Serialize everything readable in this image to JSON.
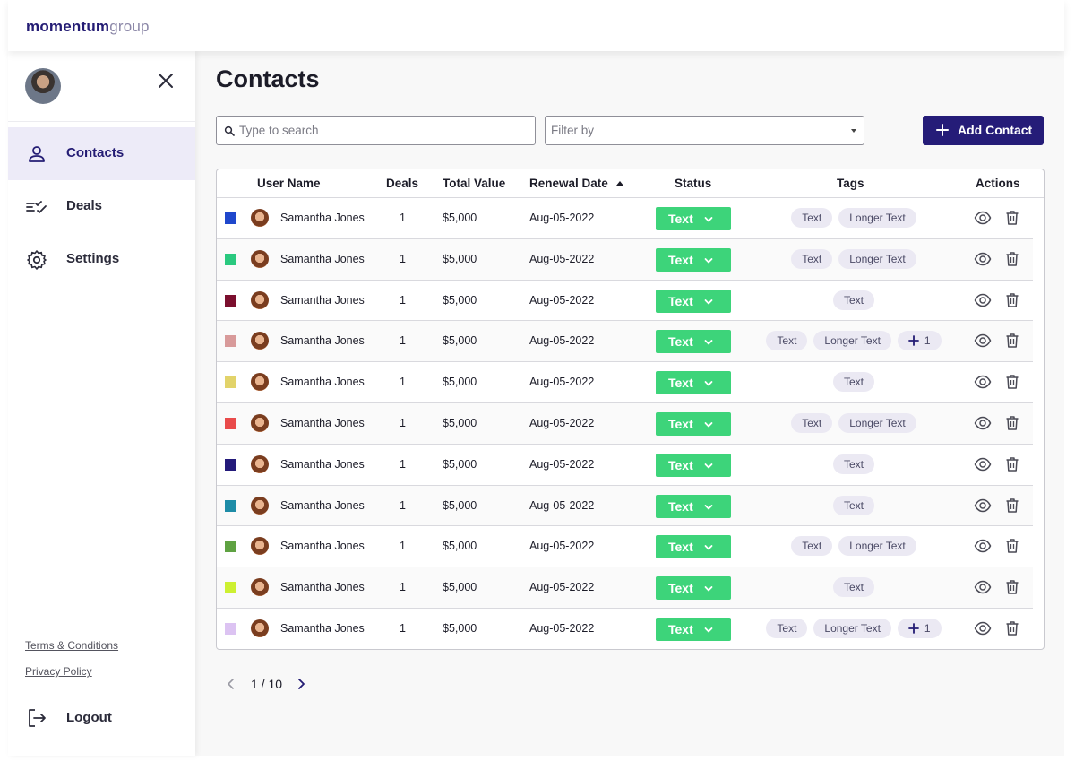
{
  "brand": {
    "logo_bold": "momentum",
    "logo_light": "group"
  },
  "sidebar": {
    "items": [
      {
        "label": "Contacts",
        "icon": "person-icon",
        "active": true
      },
      {
        "label": "Deals",
        "icon": "checklist-icon",
        "active": false
      },
      {
        "label": "Settings",
        "icon": "gear-icon",
        "active": false
      }
    ],
    "terms": "Terms & Conditions",
    "privacy": "Privacy Policy",
    "logout": "Logout"
  },
  "page": {
    "title": "Contacts"
  },
  "toolbar": {
    "search_placeholder": "Type to search",
    "filter_placeholder": "Filter by",
    "add_label": "Add Contact"
  },
  "table": {
    "columns": {
      "user": "User Name",
      "deals": "Deals",
      "value": "Total Value",
      "renewal": "Renewal Date",
      "status": "Status",
      "tags": "Tags",
      "actions": "Actions"
    },
    "sort": {
      "column": "Renewal Date",
      "direction": "ascending"
    },
    "rows": [
      {
        "color": "#1f47cc",
        "name": "Samantha Jones",
        "deals": "1",
        "value": "$5,000",
        "renewal": "Aug-05-2022",
        "status": "Text",
        "tags": [
          "Text",
          "Longer Text"
        ],
        "more": ""
      },
      {
        "color": "#2ac97f",
        "name": "Samantha Jones",
        "deals": "1",
        "value": "$5,000",
        "renewal": "Aug-05-2022",
        "status": "Text",
        "tags": [
          "Text",
          "Longer Text"
        ],
        "more": ""
      },
      {
        "color": "#7b0f2e",
        "name": "Samantha Jones",
        "deals": "1",
        "value": "$5,000",
        "renewal": "Aug-05-2022",
        "status": "Text",
        "tags": [
          "Text"
        ],
        "more": ""
      },
      {
        "color": "#d89a9a",
        "name": "Samantha Jones",
        "deals": "1",
        "value": "$5,000",
        "renewal": "Aug-05-2022",
        "status": "Text",
        "tags": [
          "Text",
          "Longer Text"
        ],
        "more": "1"
      },
      {
        "color": "#e2d36a",
        "name": "Samantha Jones",
        "deals": "1",
        "value": "$5,000",
        "renewal": "Aug-05-2022",
        "status": "Text",
        "tags": [
          "Text"
        ],
        "more": ""
      },
      {
        "color": "#e94b4b",
        "name": "Samantha Jones",
        "deals": "1",
        "value": "$5,000",
        "renewal": "Aug-05-2022",
        "status": "Text",
        "tags": [
          "Text",
          "Longer Text"
        ],
        "more": ""
      },
      {
        "color": "#231a7a",
        "name": "Samantha Jones",
        "deals": "1",
        "value": "$5,000",
        "renewal": "Aug-05-2022",
        "status": "Text",
        "tags": [
          "Text"
        ],
        "more": ""
      },
      {
        "color": "#1e8ca7",
        "name": "Samantha Jones",
        "deals": "1",
        "value": "$5,000",
        "renewal": "Aug-05-2022",
        "status": "Text",
        "tags": [
          "Text"
        ],
        "more": ""
      },
      {
        "color": "#5fa242",
        "name": "Samantha Jones",
        "deals": "1",
        "value": "$5,000",
        "renewal": "Aug-05-2022",
        "status": "Text",
        "tags": [
          "Text",
          "Longer Text"
        ],
        "more": ""
      },
      {
        "color": "#cdf031",
        "name": "Samantha Jones",
        "deals": "1",
        "value": "$5,000",
        "renewal": "Aug-05-2022",
        "status": "Text",
        "tags": [
          "Text"
        ],
        "more": ""
      },
      {
        "color": "#dcc3f2",
        "name": "Samantha Jones",
        "deals": "1",
        "value": "$5,000",
        "renewal": "Aug-05-2022",
        "status": "Text",
        "tags": [
          "Text",
          "Longer Text"
        ],
        "more": "1"
      }
    ]
  },
  "pagination": {
    "label": "1 / 10"
  },
  "colors": {
    "brand": "#251c78",
    "status_green": "#3dd47a",
    "tag_bg": "#ebe9f3",
    "active_nav_bg": "#edebf8"
  }
}
